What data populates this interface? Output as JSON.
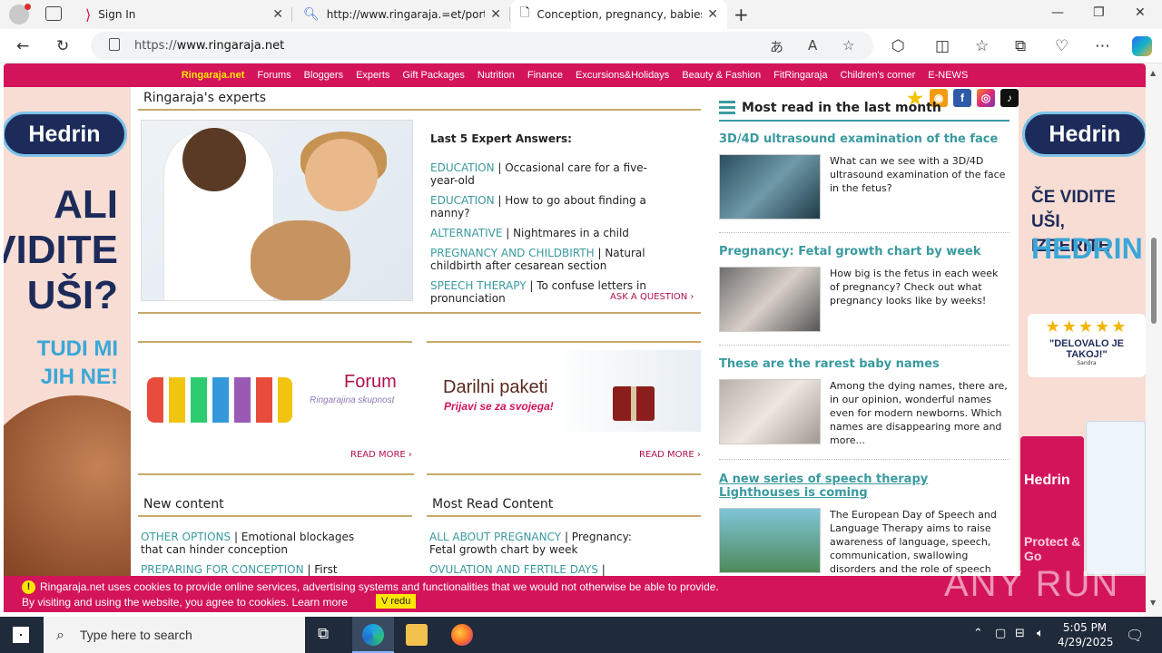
{
  "browser": {
    "tabs": [
      {
        "title": "Sign In",
        "active": false
      },
      {
        "title": "http://www.ringaraja.=et/portlet",
        "active": false
      },
      {
        "title": "Conception, pregnancy, babies a",
        "active": true
      }
    ],
    "address": {
      "prefix": "https://",
      "host": "www.ringaraja.net"
    }
  },
  "site": {
    "nav": [
      "Ringaraja.net",
      "Forums",
      "Bloggers",
      "Experts",
      "Gift Packages",
      "Nutrition",
      "Finance",
      "Excursions&Holidays",
      "Beauty & Fashion",
      "FitRingaraja",
      "Children's corner",
      "E-NEWS"
    ]
  },
  "ads": {
    "left": {
      "brand": "Hedrin",
      "headline": [
        "ALI",
        "VIDITE",
        "UŠI?"
      ],
      "sub": [
        "TUDI MI",
        "JIH NE!"
      ]
    },
    "right": {
      "brand": "Hedrin",
      "headline": [
        "ČE VIDITE UŠI,",
        "IZBERITE"
      ],
      "brand_big": "HEDRIN",
      "stars": "★★★★★",
      "quote": "\"DELOVALO JE TAKOJ!\"",
      "quote_author": "Sandra",
      "box_brand": "Hedrin",
      "box_text": "Protect & Go"
    }
  },
  "experts": {
    "title": "Ringaraja's experts",
    "answers_title": "Last 5 Expert Answers:",
    "answers": [
      {
        "cat": "EDUCATION",
        "text": "Occasional care for a five-year-old"
      },
      {
        "cat": "EDUCATION",
        "text": "How to go about finding a nanny?"
      },
      {
        "cat": "ALTERNATIVE",
        "text": "Nightmares in a child"
      },
      {
        "cat": "PREGNANCY AND CHILDBIRTH",
        "text": "Natural childbirth after cesarean section"
      },
      {
        "cat": "SPEECH THERAPY",
        "text": "To confuse letters in pronunciation"
      }
    ],
    "ask": "ASK A QUESTION ›"
  },
  "promos": {
    "forum": {
      "title": "Forum",
      "sub": "Ringarajina skupnost",
      "more": "READ MORE ›"
    },
    "gifts": {
      "title": "Darilni paketi",
      "sub": "Prijavi se za svojega!",
      "more": "READ MORE ›"
    }
  },
  "new_content": {
    "title": "New content",
    "items": [
      {
        "cat": "OTHER OPTIONS",
        "text": "Emotional blockages that can hinder conception"
      },
      {
        "cat": "PREPARING FOR CONCEPTION",
        "text": "First"
      }
    ]
  },
  "most_read_content": {
    "title": "Most Read Content",
    "items": [
      {
        "cat": "ALL ABOUT PREGNANCY",
        "text": "Pregnancy: Fetal growth chart by week"
      },
      {
        "cat": "OVULATION AND FERTILE DAYS",
        "text": ""
      }
    ]
  },
  "most_read_month": {
    "title": "Most read in the last month",
    "items": [
      {
        "title": "3D/4D ultrasound examination of the face",
        "text": "What can we see with a 3D/4D ultrasound examination of the face in the fetus?"
      },
      {
        "title": "Pregnancy: Fetal growth chart by week",
        "text": "How big is the fetus in each week of pregnancy? Check out what pregnancy looks like by weeks!"
      },
      {
        "title": "These are the rarest baby names",
        "text": "Among the dying names, there are, in our opinion, wonderful names even for modern newborns. Which names are disappearing more and more..."
      },
      {
        "title": "A new series of speech therapy Lighthouses is coming",
        "text": "The European Day of Speech and Language Therapy aims to raise awareness of language, speech, communication, swallowing disorders and the role of speech"
      }
    ]
  },
  "cookie": {
    "line1": "Ringaraja.net uses cookies to provide online services, advertising systems and functionalities that we would not otherwise be able to provide.",
    "line2": "By visiting and using the website, you agree to cookies. Learn more",
    "ok": "V redu"
  },
  "watermark": "ANY RUN",
  "taskbar": {
    "search_placeholder": "Type here to search",
    "time": "5:05 PM",
    "date": "4/29/2025"
  },
  "colors": {
    "brand": "#d4145a",
    "accent": "#3a9aa0",
    "gold": "#c9a86a"
  }
}
